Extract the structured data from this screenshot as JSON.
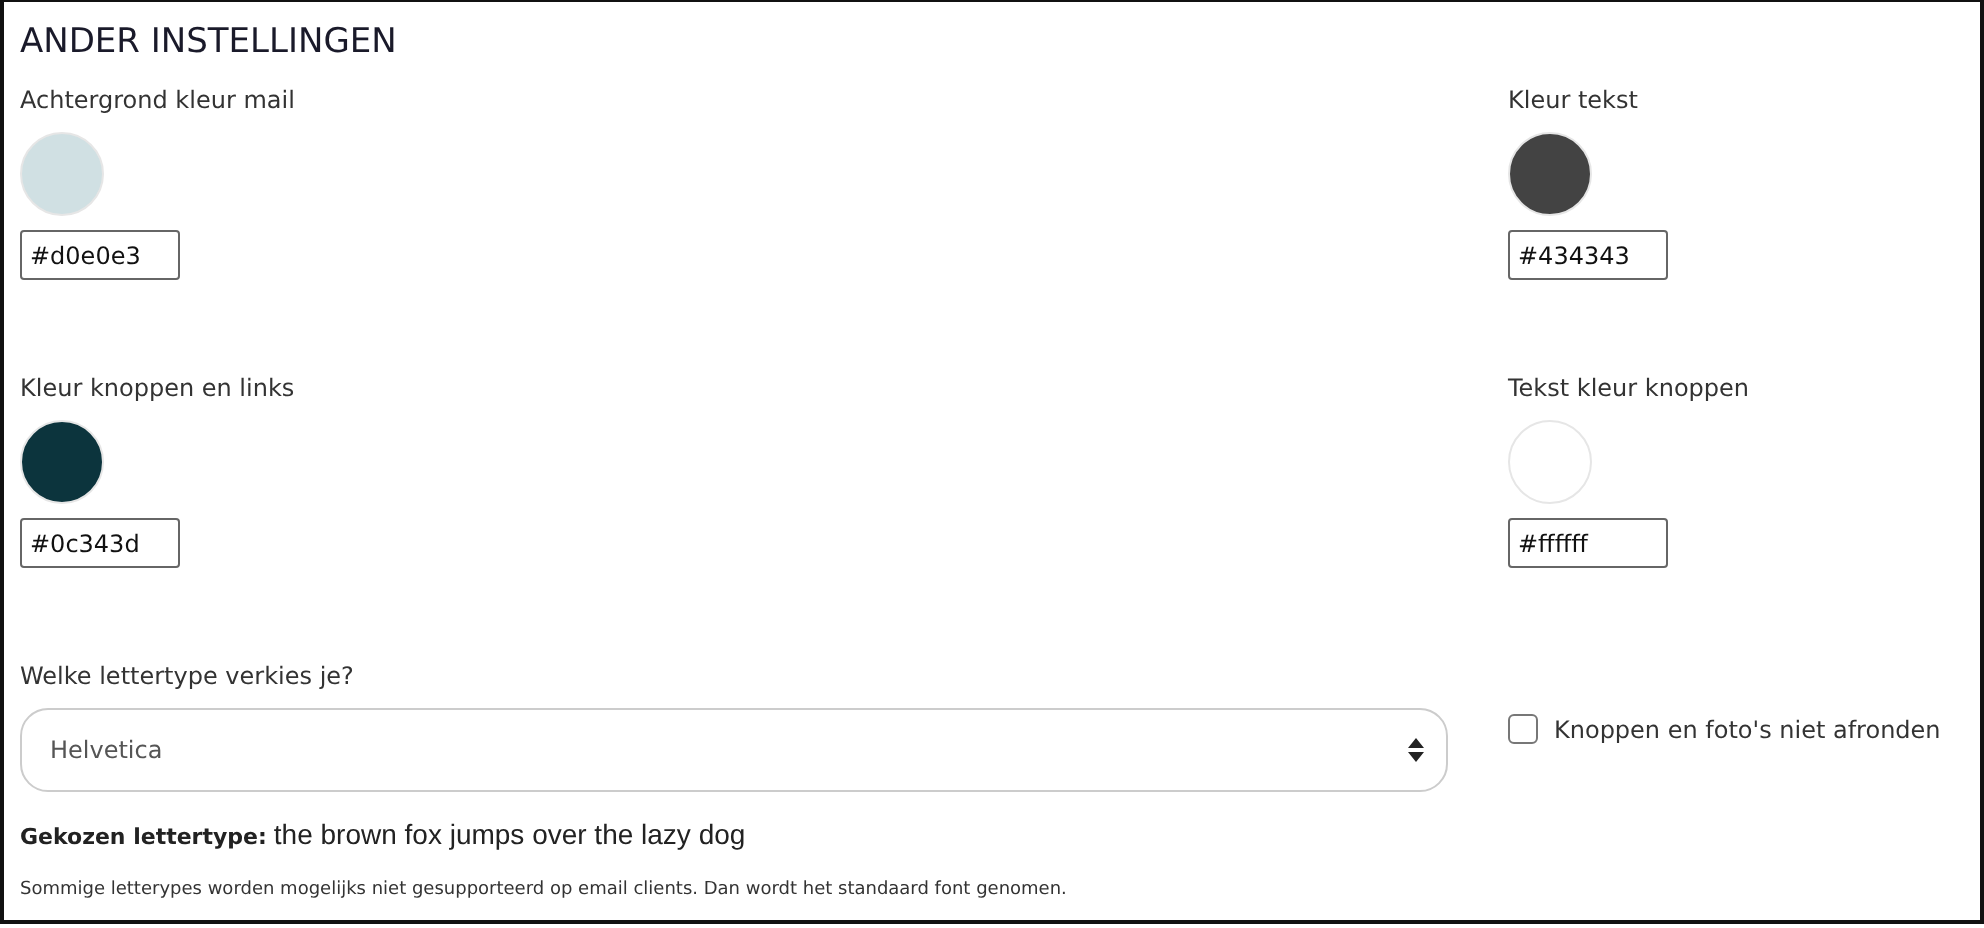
{
  "title": "ANDER INSTELLINGEN",
  "colors": [
    {
      "label": "Achtergrond kleur mail",
      "color": "#d0e0e3",
      "value": "#d0e0e3"
    },
    {
      "label": "Kleur tekst",
      "color": "#434343",
      "value": "#434343"
    },
    {
      "label": "Kleur knoppen en links",
      "color": "#0c343d",
      "value": "#0c343d"
    },
    {
      "label": "Tekst kleur knoppen",
      "color": "#ffffff",
      "value": "#ffffff"
    }
  ],
  "font": {
    "label": "Welke lettertype verkies je?",
    "value": "Helvetica",
    "chosen_label": "Gekozen lettertype:",
    "sample": "the brown fox jumps over the lazy dog",
    "note": "Sommige letterypes worden mogelijks niet gesupporteerd op email clients. Dan wordt het standaard font genomen."
  },
  "round_checkbox": {
    "label": "Knoppen en foto's niet afronden",
    "checked": false
  }
}
